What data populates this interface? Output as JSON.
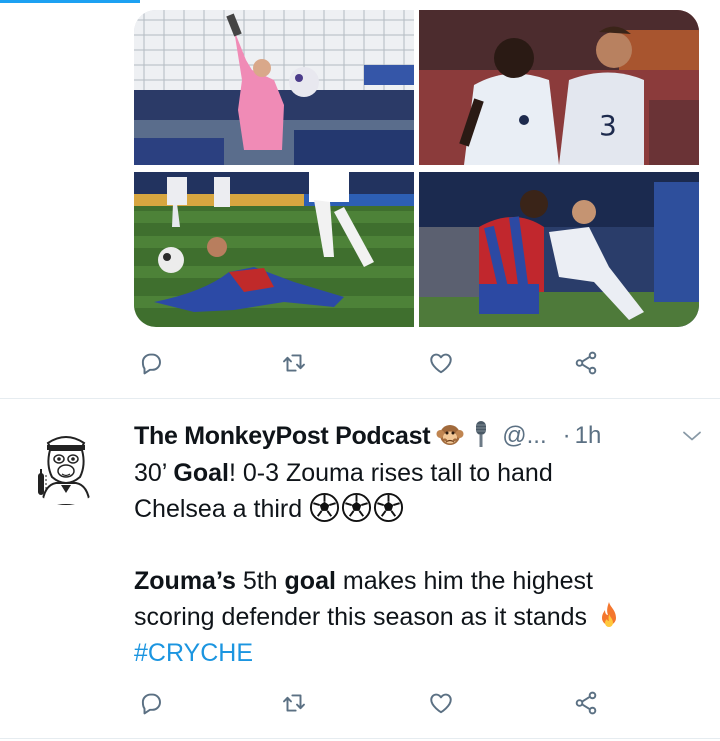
{
  "colors": {
    "accent": "#1da1f2",
    "hashtag": "#1b95e0",
    "secondary_text": "#5b7083",
    "divider": "#e6ecf0"
  },
  "previous_tweet": {
    "media": [
      {
        "name": "goalkeeper-save-photo"
      },
      {
        "name": "players-celebrating-photo"
      },
      {
        "name": "player-sliding-tackle-photo"
      },
      {
        "name": "players-challenge-photo"
      }
    ],
    "actions": [
      "reply-icon",
      "retweet-icon",
      "like-icon",
      "share-icon"
    ]
  },
  "tweet": {
    "display_name": "The MonkeyPost Podcast",
    "name_emojis": [
      "monkey-emoji",
      "microphone-emoji"
    ],
    "handle": "@...",
    "separator": "·",
    "time": "1h",
    "line1_prefix": "30’ ",
    "line1_bold": "Goal",
    "line1_suffix": "! 0-3 Zouma rises tall to hand",
    "line2_text": "Chelsea a third",
    "line2_emojis": [
      "soccer-ball-emoji",
      "soccer-ball-emoji",
      "soccer-ball-emoji"
    ],
    "line3_bold1": "Zouma’s",
    "line3_mid": " 5th ",
    "line3_bold2": "goal",
    "line3_suffix": " makes him the highest",
    "line4_text": "scoring defender this season as it stands",
    "line4_emoji": "fire-emoji",
    "hashtag": "#CRYCHE",
    "actions": [
      "reply-icon",
      "retweet-icon",
      "like-icon",
      "share-icon"
    ]
  }
}
